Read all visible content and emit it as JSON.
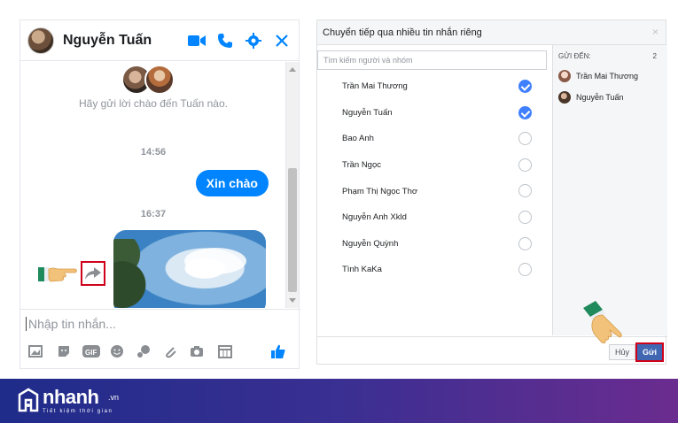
{
  "chat": {
    "contact_name": "Nguyễn Tuấn",
    "greeting": "Hãy gửi lời chào đến Tuấn nào.",
    "time1": "14:56",
    "message": "Xin chào",
    "time2": "16:37",
    "composer_placeholder": "Nhập tin nhắn...",
    "header_icons": [
      "video-icon",
      "phone-icon",
      "gear-icon",
      "close-icon"
    ],
    "toolbar_icons": [
      "image-icon",
      "sticker-icon",
      "gif-icon",
      "emoji-icon",
      "game-icon",
      "attach-icon",
      "camera-icon",
      "calendar-icon",
      "thumbs-up-icon"
    ],
    "accent": "#0084ff"
  },
  "dialog": {
    "title": "Chuyển tiếp qua nhiều tin nhắn riêng",
    "close": "×",
    "search_placeholder": "Tìm kiếm người và nhóm",
    "contacts": [
      {
        "name": "Trần Mai Thương",
        "selected": true
      },
      {
        "name": "Nguyễn Tuấn",
        "selected": true
      },
      {
        "name": "Bao Anh",
        "selected": false
      },
      {
        "name": "Trần Ngọc",
        "selected": false
      },
      {
        "name": "Phạm Thị Ngọc Thơ",
        "selected": false
      },
      {
        "name": "Nguyễn Anh Xkld",
        "selected": false
      },
      {
        "name": "Nguyễn Quỳnh",
        "selected": false
      },
      {
        "name": "Tình KaKa",
        "selected": false
      }
    ],
    "send_to_label": "GỬI ĐẾN:",
    "send_to_count": "2",
    "recipients": [
      "Trần Mai Thương",
      "Nguyễn Tuấn"
    ],
    "cancel_label": "Hủy",
    "send_label": "Gửi",
    "accent": "#4267b2",
    "highlight": "#d0021b"
  },
  "banner": {
    "brand": "nhanh",
    "tld": ".vn",
    "slogan": "Tiết kiệm thời gian"
  }
}
